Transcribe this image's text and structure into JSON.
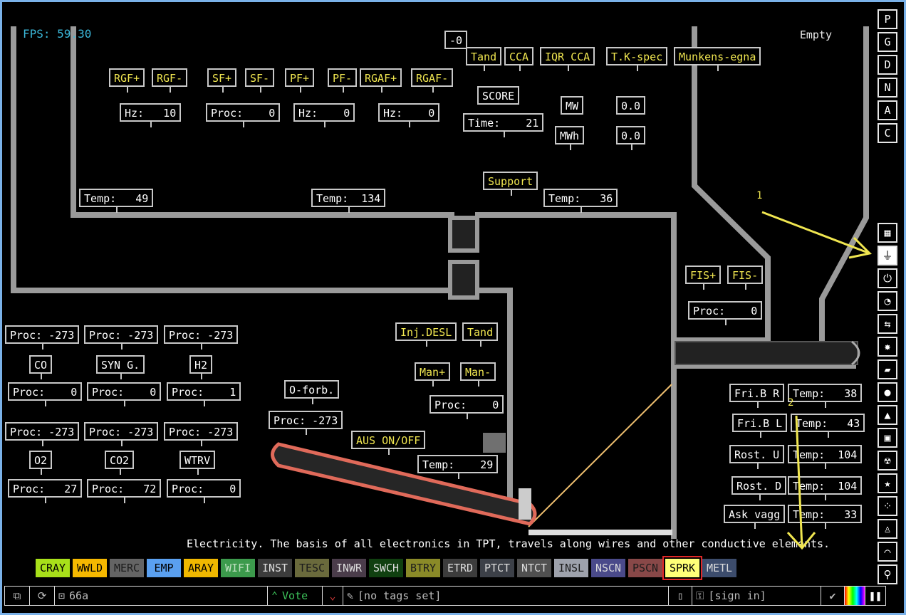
{
  "status": {
    "fps": "FPS: 59.30",
    "hover_element": "Empty"
  },
  "labels": {
    "neg0": "-0",
    "tand1": "Tand",
    "cca": "CCA",
    "iqr": "IQR CCA",
    "tkspec": "T.K-spec",
    "munkens": "Munkens-egna",
    "score": "SCORE",
    "time": "Time:    21",
    "mw": "MW",
    "mwh": "MWh",
    "v00a": "0.0",
    "v00b": "0.0",
    "rgfp": "RGF+",
    "rgfm": "RGF-",
    "sfp": "SF+",
    "sfm": "SF-",
    "pfp": "PF+",
    "pfm": "PF-",
    "rgafp": "RGAF+",
    "rgafm": "RGAF-",
    "hz1": "Hz:   10",
    "proc1": "Proc:    0",
    "hz2": "Hz:    0",
    "hz3": "Hz:    0",
    "support": "Support",
    "temp49": "Temp:   49",
    "temp134": "Temp:  134",
    "temp36": "Temp:   36",
    "fisp": "FIS+",
    "fism": "FIS-",
    "procfis": "Proc:    0",
    "p273a": "Proc: -273",
    "p273b": "Proc: -273",
    "p273c": "Proc: -273",
    "co": "CO",
    "syng": "SYN G.",
    "h2": "H2",
    "pco": "Proc:    0",
    "psyng": "Proc:    0",
    "ph2": "Proc:    1",
    "p273d": "Proc: -273",
    "p273e": "Proc: -273",
    "p273f": "Proc: -273",
    "o2": "O2",
    "co2": "CO2",
    "wtrv": "WTRV",
    "po2": "Proc:   27",
    "pco2": "Proc:   72",
    "pwtrv": "Proc:    0",
    "oforb": "O-forb.",
    "poforb": "Proc: -273",
    "injdesl": "Inj.DESL",
    "tand2": "Tand",
    "manp": "Man+",
    "manm": "Man-",
    "pman": "Proc:    0",
    "aus": "AUS ON/OFF",
    "temp29": "Temp:    29",
    "fribr": "Fri.B R",
    "fribl": "Fri.B L",
    "rostu": "Rost. U",
    "rostd": "Rost. D",
    "askvagg": "Ask vagg",
    "t38": "Temp:   38",
    "t43": "Temp:   43",
    "t104a": "Temp:  104",
    "t104b": "Temp:  104",
    "t33": "Temp:   33"
  },
  "description": "Electricity. The basis of all electronics in TPT, travels along wires and other conductive elements.",
  "annotations": {
    "a1": "1",
    "a2": "2"
  },
  "right_toolbar": {
    "top": [
      "P",
      "G",
      "D",
      "N",
      "A",
      "C"
    ],
    "categories": [
      "walls-icon",
      "electronics-icon",
      "powered-icon",
      "sensors-icon",
      "force-icon",
      "explosives-icon",
      "gases-icon",
      "liquids-icon",
      "powders-icon",
      "solids-icon",
      "radioactive-icon",
      "special-icon",
      "life-icon",
      "tools-icon",
      "favorites-icon",
      "search-icon"
    ]
  },
  "elements": [
    {
      "name": "CRAY",
      "bg": "#a8e01a",
      "fg": "#000"
    },
    {
      "name": "WWLD",
      "bg": "#f5b800",
      "fg": "#000"
    },
    {
      "name": "MERC",
      "bg": "#646464",
      "fg": "#1c1c1c"
    },
    {
      "name": "EMP",
      "bg": "#5aa0f0",
      "fg": "#000"
    },
    {
      "name": "ARAY",
      "bg": "#f0b800",
      "fg": "#000"
    },
    {
      "name": "WIFI",
      "bg": "#3c9a4c",
      "fg": "#bfe0c0"
    },
    {
      "name": "INST",
      "bg": "#3c3c3c",
      "fg": "#dcdcdc"
    },
    {
      "name": "TESC",
      "bg": "#6a6a3c",
      "fg": "#1c1c1c"
    },
    {
      "name": "INWR",
      "bg": "#4a3c4a",
      "fg": "#dcdcdc"
    },
    {
      "name": "SWCH",
      "bg": "#104010",
      "fg": "#dcdcdc"
    },
    {
      "name": "BTRY",
      "bg": "#8a8a28",
      "fg": "#1c1c1c"
    },
    {
      "name": "ETRD",
      "bg": "#3c3c3c",
      "fg": "#dcdcdc"
    },
    {
      "name": "PTCT",
      "bg": "#3c4048",
      "fg": "#dcdcdc"
    },
    {
      "name": "NTCT",
      "bg": "#505050",
      "fg": "#dcdcdc"
    },
    {
      "name": "INSL",
      "bg": "#9ea2ac",
      "fg": "#1c1c1c"
    },
    {
      "name": "NSCN",
      "bg": "#4a4a8a",
      "fg": "#dcdcdc"
    },
    {
      "name": "PSCN",
      "bg": "#884848",
      "fg": "#1c1c1c"
    },
    {
      "name": "SPRK",
      "bg": "#ffff78",
      "fg": "#000",
      "selected": true
    },
    {
      "name": "METL",
      "bg": "#3c4c6c",
      "fg": "#dcdcdc"
    }
  ],
  "bottom_bar": {
    "save_id": "66a",
    "vote_label": "Vote",
    "tags": "[no tags set]",
    "sign_in": "[sign in]"
  }
}
